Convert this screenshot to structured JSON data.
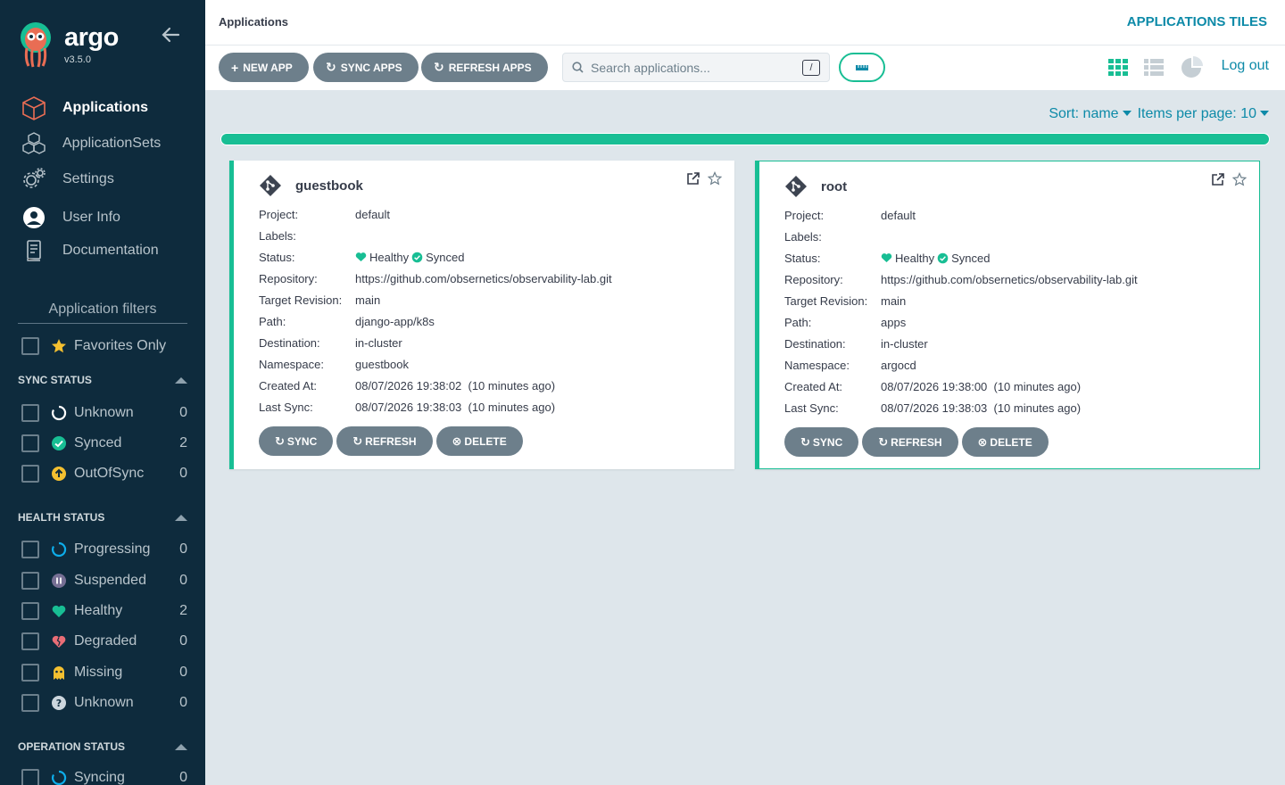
{
  "sidebar": {
    "brand": "argo",
    "version": "v3.5.0",
    "nav": [
      {
        "label": "Applications",
        "icon": "cube-icon"
      },
      {
        "label": "ApplicationSets",
        "icon": "cubes-icon"
      },
      {
        "label": "Settings",
        "icon": "gears-icon"
      },
      {
        "label": "User Info",
        "icon": "user-circle-icon"
      },
      {
        "label": "Documentation",
        "icon": "book-icon"
      }
    ],
    "filters_title": "Application filters",
    "favorites_label": "Favorites Only",
    "sync_status": {
      "title": "SYNC STATUS",
      "items": [
        {
          "label": "Unknown",
          "count": "0"
        },
        {
          "label": "Synced",
          "count": "2"
        },
        {
          "label": "OutOfSync",
          "count": "0"
        }
      ]
    },
    "health_status": {
      "title": "HEALTH STATUS",
      "items": [
        {
          "label": "Progressing",
          "count": "0"
        },
        {
          "label": "Suspended",
          "count": "0"
        },
        {
          "label": "Healthy",
          "count": "2"
        },
        {
          "label": "Degraded",
          "count": "0"
        },
        {
          "label": "Missing",
          "count": "0"
        },
        {
          "label": "Unknown",
          "count": "0"
        }
      ]
    },
    "operation_status": {
      "title": "OPERATION STATUS",
      "items": [
        {
          "label": "Syncing",
          "count": "0"
        }
      ]
    }
  },
  "header": {
    "breadcrumb": "Applications",
    "title": "APPLICATIONS TILES"
  },
  "toolbar": {
    "new_app": "NEW APP",
    "sync_apps": "SYNC APPS",
    "refresh_apps": "REFRESH APPS",
    "search_placeholder": "Search applications...",
    "search_shortcut": "/",
    "logout": "Log out"
  },
  "sort": {
    "sort_label": "Sort: name",
    "items_label": "Items per page: 10"
  },
  "colors": {
    "accent": "#18be94",
    "link": "#0d8aa8",
    "sidebar_bg": "#0e2b3d",
    "button_gray": "#6d7f8b"
  },
  "field_labels": {
    "project": "Project:",
    "labels": "Labels:",
    "status": "Status:",
    "repository": "Repository:",
    "target_revision": "Target Revision:",
    "path": "Path:",
    "destination": "Destination:",
    "namespace": "Namespace:",
    "created_at": "Created At:",
    "last_sync": "Last Sync:"
  },
  "card_buttons": {
    "sync": "SYNC",
    "refresh": "REFRESH",
    "delete": "DELETE"
  },
  "apps": [
    {
      "name": "guestbook",
      "project": "default",
      "labels": "",
      "health": "Healthy",
      "sync": "Synced",
      "repository": "https://github.com/obsernetics/observability-lab.git",
      "target_revision": "main",
      "path": "django-app/k8s",
      "destination": "in-cluster",
      "namespace": "guestbook",
      "created_at": "08/07/2026 19:38:02  (10 minutes ago)",
      "last_sync": "08/07/2026 19:38:03  (10 minutes ago)"
    },
    {
      "name": "root",
      "project": "default",
      "labels": "",
      "health": "Healthy",
      "sync": "Synced",
      "repository": "https://github.com/obsernetics/observability-lab.git",
      "target_revision": "main",
      "path": "apps",
      "destination": "in-cluster",
      "namespace": "argocd",
      "created_at": "08/07/2026 19:38:00  (10 minutes ago)",
      "last_sync": "08/07/2026 19:38:03  (10 minutes ago)"
    }
  ]
}
